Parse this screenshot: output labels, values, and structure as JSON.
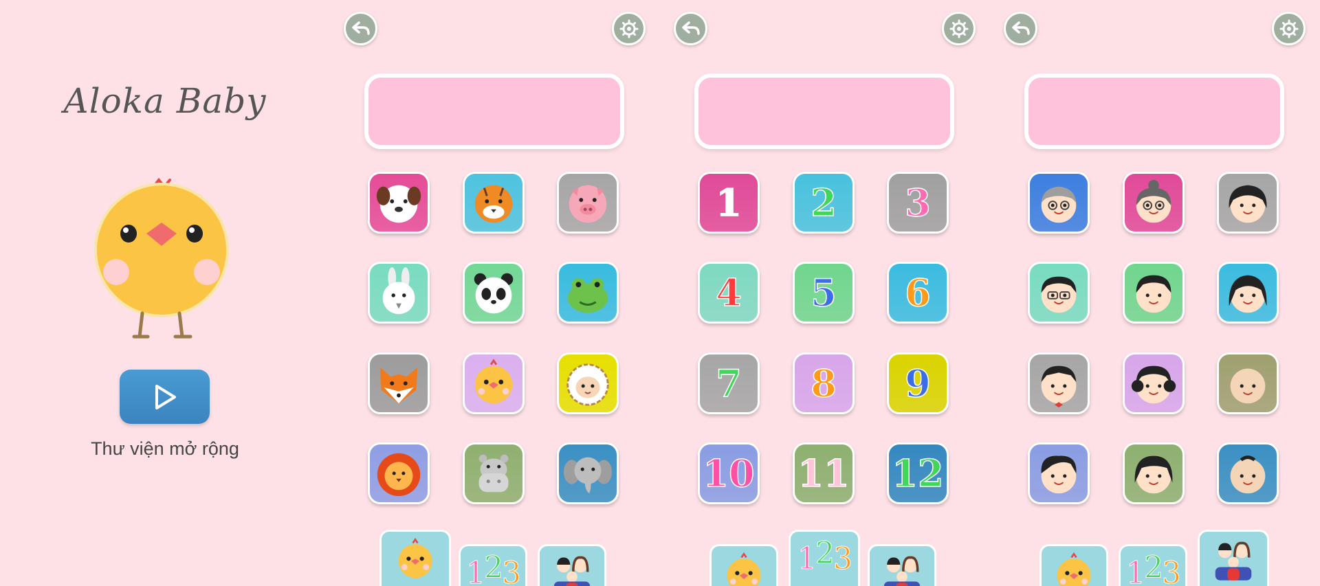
{
  "app": {
    "brand": "Aloka Baby",
    "play_icon": "play-icon",
    "library_label": "Thư viện mở rộng"
  },
  "panels": [
    {
      "name": "animals",
      "selected_tab": 0,
      "tiles": [
        {
          "icon": "dog-icon",
          "bg": "#e54c98"
        },
        {
          "icon": "tiger-icon",
          "bg": "#4ec3df"
        },
        {
          "icon": "pig-icon",
          "bg": "#a6a6a6"
        },
        {
          "icon": "rabbit-icon",
          "bg": "#78dcc0"
        },
        {
          "icon": "panda-icon",
          "bg": "#72d896"
        },
        {
          "icon": "frog-icon",
          "bg": "#38bce0"
        },
        {
          "icon": "fox-icon",
          "bg": "#9c9c9c"
        },
        {
          "icon": "chick-icon",
          "bg": "#dab0ef"
        },
        {
          "icon": "sheep-icon",
          "bg": "#e6e000"
        },
        {
          "icon": "lion-icon",
          "bg": "#8f9ee4"
        },
        {
          "icon": "hippo-icon",
          "bg": "#8fb070"
        },
        {
          "icon": "elephant-icon",
          "bg": "#3a90c3"
        }
      ]
    },
    {
      "name": "numbers",
      "selected_tab": 1,
      "tiles": [
        {
          "label": "1",
          "bg": "#e04a98",
          "fg": "#ffffff"
        },
        {
          "label": "2",
          "bg": "#48c2de",
          "fg": "#3fd65a"
        },
        {
          "label": "3",
          "bg": "#a0a0a0",
          "fg": "#ff6ab0"
        },
        {
          "label": "4",
          "bg": "#7fd9c2",
          "fg": "#ff3b3b"
        },
        {
          "label": "5",
          "bg": "#70d68e",
          "fg": "#3b6ee6"
        },
        {
          "label": "6",
          "bg": "#3bbce0",
          "fg": "#ff9a1a"
        },
        {
          "label": "7",
          "bg": "#a6a6a6",
          "fg": "#3fd65a"
        },
        {
          "label": "8",
          "bg": "#d7a6ea",
          "fg": "#ff9a1a"
        },
        {
          "label": "9",
          "bg": "#d9d400",
          "fg": "#3b6ee6"
        },
        {
          "label": "10",
          "bg": "#8a9de3",
          "fg": "#ff4fa6"
        },
        {
          "label": "11",
          "bg": "#8db070",
          "fg": "#ffc4d6"
        },
        {
          "label": "12",
          "bg": "#3388c0",
          "fg": "#3fd65a"
        }
      ]
    },
    {
      "name": "family",
      "selected_tab": 2,
      "tiles": [
        {
          "icon": "grandfather-icon",
          "bg": "#3d7fe0"
        },
        {
          "icon": "grandmother-icon",
          "bg": "#e04a98"
        },
        {
          "icon": "girl-icon",
          "bg": "#a6a6a6"
        },
        {
          "icon": "father-icon",
          "bg": "#78dcc0"
        },
        {
          "icon": "uncle-icon",
          "bg": "#70d68e"
        },
        {
          "icon": "mother-icon",
          "bg": "#3bbce0"
        },
        {
          "icon": "boy-icon",
          "bg": "#a6a6a6"
        },
        {
          "icon": "aunt-icon",
          "bg": "#d7a6ea"
        },
        {
          "icon": "baby-icon",
          "bg": "#9fa070"
        },
        {
          "icon": "young-man-icon",
          "bg": "#8a9de3"
        },
        {
          "icon": "young-woman-icon",
          "bg": "#8db070"
        },
        {
          "icon": "toddler-icon",
          "bg": "#3a90c3"
        }
      ]
    }
  ],
  "tabs": [
    {
      "icon": "chick-icon"
    },
    {
      "label_parts": [
        "1",
        "2",
        "3"
      ],
      "colors": [
        "#ff6ab0",
        "#3fd65a",
        "#ff9a1a"
      ]
    },
    {
      "icon": "family-icon"
    }
  ],
  "colors": {
    "background": "#fde1e6",
    "display_box": "#ffc2da",
    "round_button": "#9fae9f",
    "play_button": "#3f8cc8",
    "tab_bar": "#9cd8e0"
  }
}
